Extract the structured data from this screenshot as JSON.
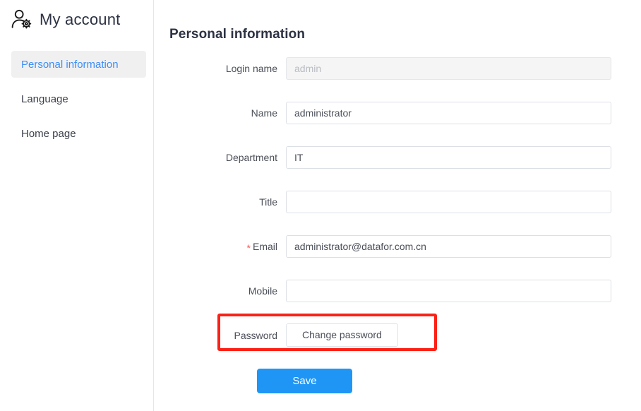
{
  "sidebar": {
    "brand": {
      "icon": "user-settings-icon",
      "title": "My account"
    },
    "items": [
      {
        "label": "Personal information",
        "active": true
      },
      {
        "label": "Language",
        "active": false
      },
      {
        "label": "Home page",
        "active": false
      }
    ]
  },
  "main": {
    "title": "Personal information",
    "fields": [
      {
        "label": "Login name",
        "required": false,
        "value": "",
        "placeholder": "admin",
        "disabled": true,
        "name": "login-name"
      },
      {
        "label": "Name",
        "required": false,
        "value": "administrator",
        "placeholder": "",
        "disabled": false,
        "name": "name"
      },
      {
        "label": "Department",
        "required": false,
        "value": "IT",
        "placeholder": "",
        "disabled": false,
        "name": "department"
      },
      {
        "label": "Title",
        "required": false,
        "value": "",
        "placeholder": "",
        "disabled": false,
        "name": "title"
      },
      {
        "label": "Email",
        "required": true,
        "required_marker": "*",
        "value": "administrator@datafor.com.cn",
        "placeholder": "",
        "disabled": false,
        "name": "email"
      },
      {
        "label": "Mobile",
        "required": false,
        "value": "",
        "placeholder": "",
        "disabled": false,
        "name": "mobile"
      }
    ],
    "password_row": {
      "label": "Password",
      "button_label": "Change password"
    },
    "save_label": "Save"
  },
  "annotation": {
    "highlight_color": "#fb2116",
    "target": "password-row"
  },
  "colors": {
    "accent_blue": "#1f96f5",
    "active_nav_text": "#3d8ef8",
    "active_nav_bg": "#f0f0f0",
    "required_star": "#f05b5b",
    "border": "#dcdfe6",
    "disabled_bg": "#f5f5f5"
  }
}
